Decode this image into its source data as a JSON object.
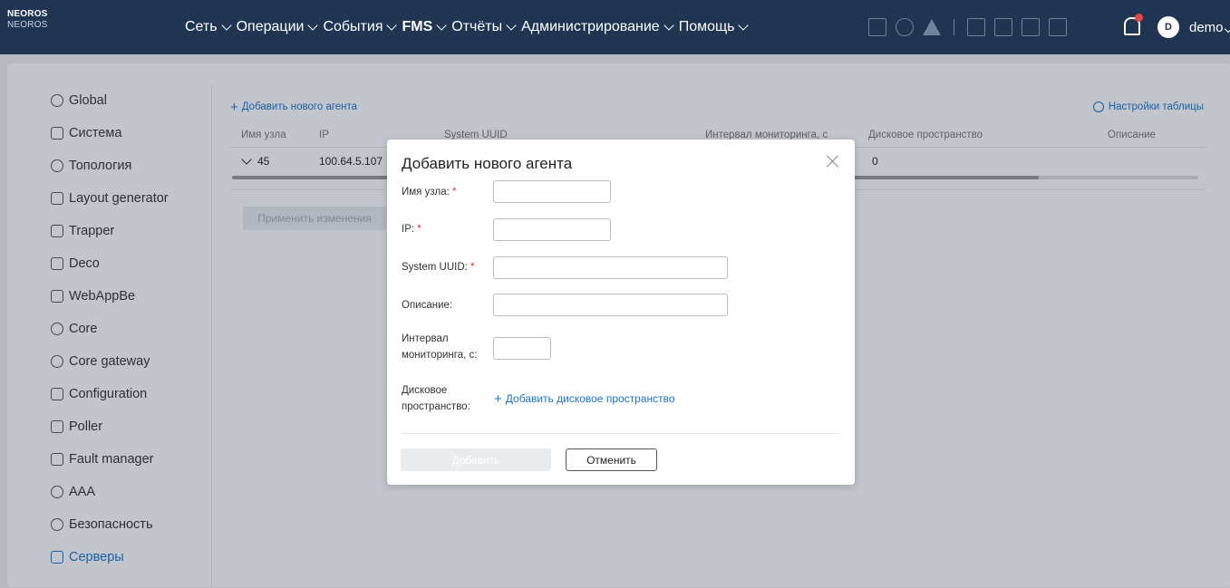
{
  "app": {
    "logo_line1": "NEOROS",
    "logo_line2": "NEOROS"
  },
  "nav": [
    {
      "label": "Сеть",
      "bold": false
    },
    {
      "label": "Операции",
      "bold": false
    },
    {
      "label": "События",
      "bold": false
    },
    {
      "label": "FMS",
      "bold": true
    },
    {
      "label": "Отчёты",
      "bold": false
    },
    {
      "label": "Администрирование",
      "bold": false
    },
    {
      "label": "Помощь",
      "bold": false
    }
  ],
  "user": {
    "avatar_letter": "D",
    "name": "demo"
  },
  "sidebar": {
    "items": [
      {
        "label": "Global",
        "icon": "gear-icon"
      },
      {
        "label": "Система",
        "icon": "network-icon"
      },
      {
        "label": "Топология",
        "icon": "location-icon"
      },
      {
        "label": "Layout generator",
        "icon": "layers-icon"
      },
      {
        "label": "Trapper",
        "icon": "trapper-icon"
      },
      {
        "label": "Deco",
        "icon": "list-icon"
      },
      {
        "label": "WebAppBe",
        "icon": "window-icon"
      },
      {
        "label": "Core",
        "icon": "chip-icon"
      },
      {
        "label": "Core gateway",
        "icon": "gateway-icon"
      },
      {
        "label": "Configuration",
        "icon": "sliders-icon"
      },
      {
        "label": "Poller",
        "icon": "chart-icon"
      },
      {
        "label": "Fault manager",
        "icon": "calendar-icon"
      },
      {
        "label": "AAA",
        "icon": "user-icon"
      },
      {
        "label": "Безопасность",
        "icon": "shield-icon"
      },
      {
        "label": "Серверы",
        "icon": "server-icon"
      }
    ],
    "active_index": 14
  },
  "toolbar": {
    "add_agent": "Добавить нового агента",
    "table_settings": "Настройки таблицы",
    "apply": "Применить изменения"
  },
  "table": {
    "headers": {
      "node": "Имя узла",
      "ip": "IP",
      "uuid": "System UUID",
      "interval": "Интервал мониторинга, с",
      "disk": "Дисковое пространство",
      "desc": "Описание"
    },
    "row": {
      "node": "45",
      "ip": "100.64.5.107",
      "disk": "0"
    }
  },
  "modal": {
    "title": "Добавить нового агента",
    "fields": {
      "node_label": "Имя узла:",
      "ip_label": "IP:",
      "uuid_label": "System UUID:",
      "desc_label": "Описание:",
      "interval_label_1": "Интервал",
      "interval_label_2": "мониторинга, с:",
      "disk_label_1": "Дисковое",
      "disk_label_2": "пространство:",
      "required_mark": "*"
    },
    "add_disk": "Добавить дисковое пространство",
    "submit": "Добавить",
    "cancel": "Отменить"
  }
}
